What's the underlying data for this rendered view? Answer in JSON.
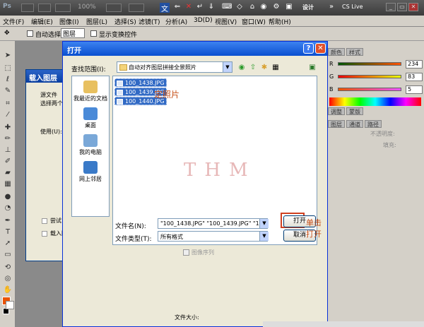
{
  "app": {
    "logo": "Ps",
    "zoom": "100%",
    "design": "设计",
    "cslive": "CS Live"
  },
  "menu": [
    "文件(F)",
    "编辑(E)",
    "图像(I)",
    "图层(L)",
    "选择(S)",
    "滤镜(T)",
    "分析(A)",
    "3D(D)",
    "视图(V)",
    "窗口(W)",
    "帮助(H)"
  ],
  "options": {
    "auto_select": "自动选择:",
    "layer": "图层",
    "show_transform": "显示变换控件"
  },
  "right_panel": {
    "tabs_top": [
      "颜色",
      "样式"
    ],
    "tabs_mid": [
      "调整",
      "蒙版"
    ],
    "tabs_low": [
      "图层",
      "通道",
      "路径"
    ],
    "R": "234",
    "G": "83",
    "B": "5",
    "opacity_label": "不透明度:",
    "fill_label": "填充:"
  },
  "load_window": {
    "title": "载入图层",
    "source_label": "源文件",
    "choose_label": "选择两个",
    "use_label": "使用(U):",
    "try_label": "尝试",
    "load_label": "载入图"
  },
  "dialog": {
    "title": "打开",
    "look_in_label": "查找范围(I):",
    "folder": "自动对齐图层拼接全景照片",
    "places": [
      {
        "label": "我最近的文档"
      },
      {
        "label": "桌面"
      },
      {
        "label": "我的电脑"
      },
      {
        "label": "网上邻居"
      }
    ],
    "files": [
      "100_1438.JPG",
      "100_1439.JPG",
      "100_1440.JPG"
    ],
    "annotation_select": "定照片",
    "watermark": "THM",
    "filename_label": "文件名(N):",
    "filename_value": "\"100_1438.JPG\" \"100_1439.JPG\" \"100_144",
    "filetype_label": "文件类型(T):",
    "filetype_value": "所有格式",
    "open_button": "打开",
    "cancel_button": "取消",
    "annotation_open": "单击打开",
    "image_sequence": "图像序列",
    "file_size": "文件大小:"
  }
}
